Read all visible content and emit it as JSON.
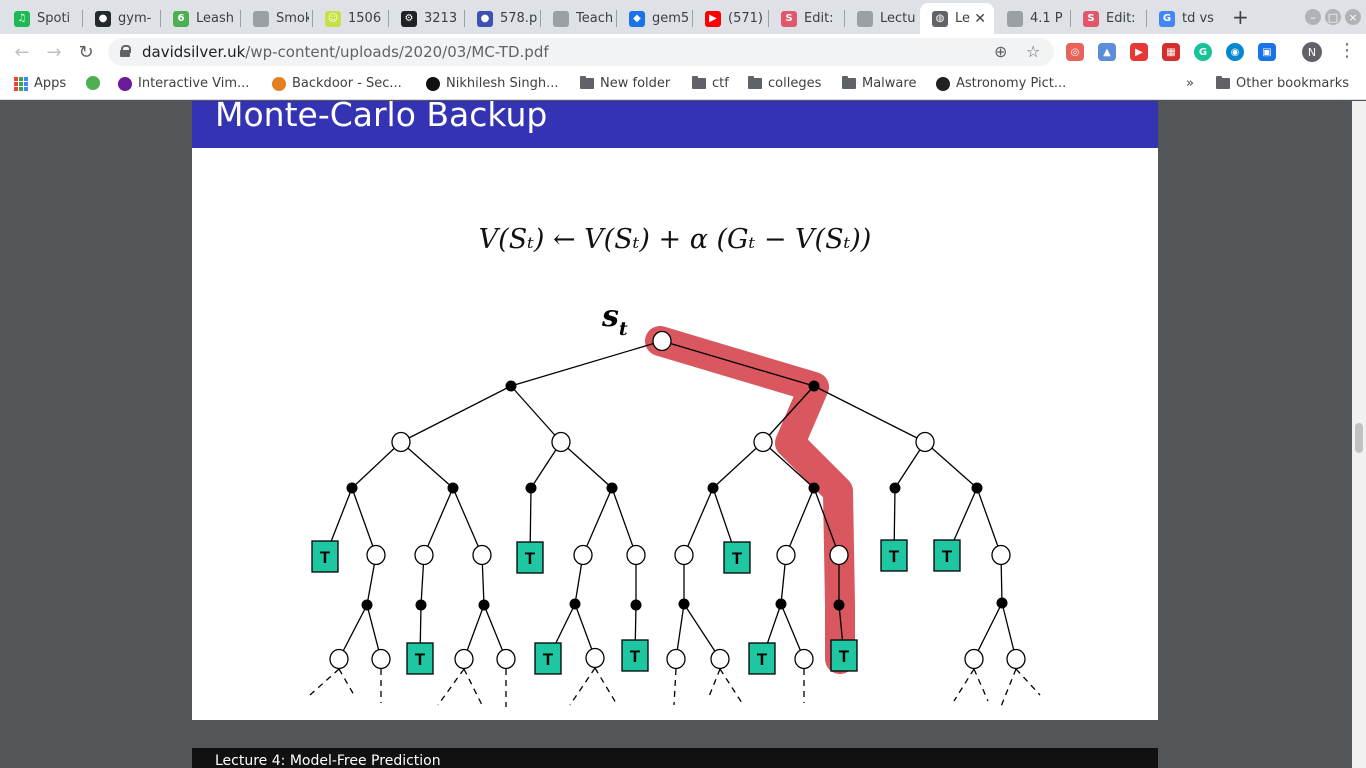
{
  "tabs": [
    {
      "title": "Spoti",
      "color": "#1db954",
      "glyph": "♫"
    },
    {
      "title": "gym-",
      "color": "#24292e",
      "glyph": "●"
    },
    {
      "title": "Leash",
      "color": "#4caf50",
      "glyph": "6"
    },
    {
      "title": "Smok",
      "color": "#9aa0a6",
      "glyph": ""
    },
    {
      "title": "1506",
      "color": "#c6e048",
      "glyph": "☺"
    },
    {
      "title": "3213",
      "color": "#202124",
      "glyph": "⚙"
    },
    {
      "title": "578.p",
      "color": "#3f51b5",
      "glyph": "●"
    },
    {
      "title": "Teach",
      "color": "#9aa0a6",
      "glyph": ""
    },
    {
      "title": "gem5",
      "color": "#1a73e8",
      "glyph": "◆"
    },
    {
      "title": "(571)",
      "color": "#ff0000",
      "glyph": "▶"
    },
    {
      "title": "Edit:",
      "color": "#e2576c",
      "glyph": "S"
    },
    {
      "title": "Lectu",
      "color": "#9aa0a6",
      "glyph": ""
    },
    {
      "title": "Le",
      "color": "#5f6368",
      "glyph": "◍",
      "active": true
    },
    {
      "title": "4.1 P",
      "color": "#9aa0a6",
      "glyph": ""
    },
    {
      "title": "Edit:",
      "color": "#e2576c",
      "glyph": "S"
    },
    {
      "title": "td vs",
      "color": "#4285f4",
      "glyph": "G"
    }
  ],
  "new_tab_glyph": "+",
  "close_tab_glyph": "✕",
  "url": {
    "host": "davidsilver.uk",
    "path": "/wp-content/uploads/2020/03/MC-TD.pdf"
  },
  "profile_initial": "N",
  "bookmarks": [
    {
      "label": "Apps",
      "type": "apps"
    },
    {
      "label": "",
      "type": "icon",
      "color": "#4caf50"
    },
    {
      "label": "Interactive Vim...",
      "type": "icon",
      "color": "#6a1b9a"
    },
    {
      "label": "Backdoor - Sec...",
      "type": "icon",
      "color": "#e67e22"
    },
    {
      "label": "Nikhilesh Singh...",
      "type": "icon",
      "color": "#111111"
    },
    {
      "label": "New folder",
      "type": "folder"
    },
    {
      "label": "ctf",
      "type": "folder"
    },
    {
      "label": "colleges",
      "type": "folder"
    },
    {
      "label": "Malware",
      "type": "folder"
    },
    {
      "label": "Astronomy Pict...",
      "type": "icon",
      "color": "#222222"
    }
  ],
  "bookmarks_overflow": "»",
  "other_bookmarks": "Other bookmarks",
  "slide": {
    "title": "Monte-Carlo Backup",
    "formula": "V(Sₜ) ← V(Sₜ) + α (Gₜ − V(Sₜ))",
    "root_label": "s",
    "root_subscript": "t",
    "terminal_label": "T",
    "highlight_color": "#d9575e",
    "terminal_color": "#1ec7a1",
    "footer": "Lecture 4: Model-Free Prediction"
  }
}
